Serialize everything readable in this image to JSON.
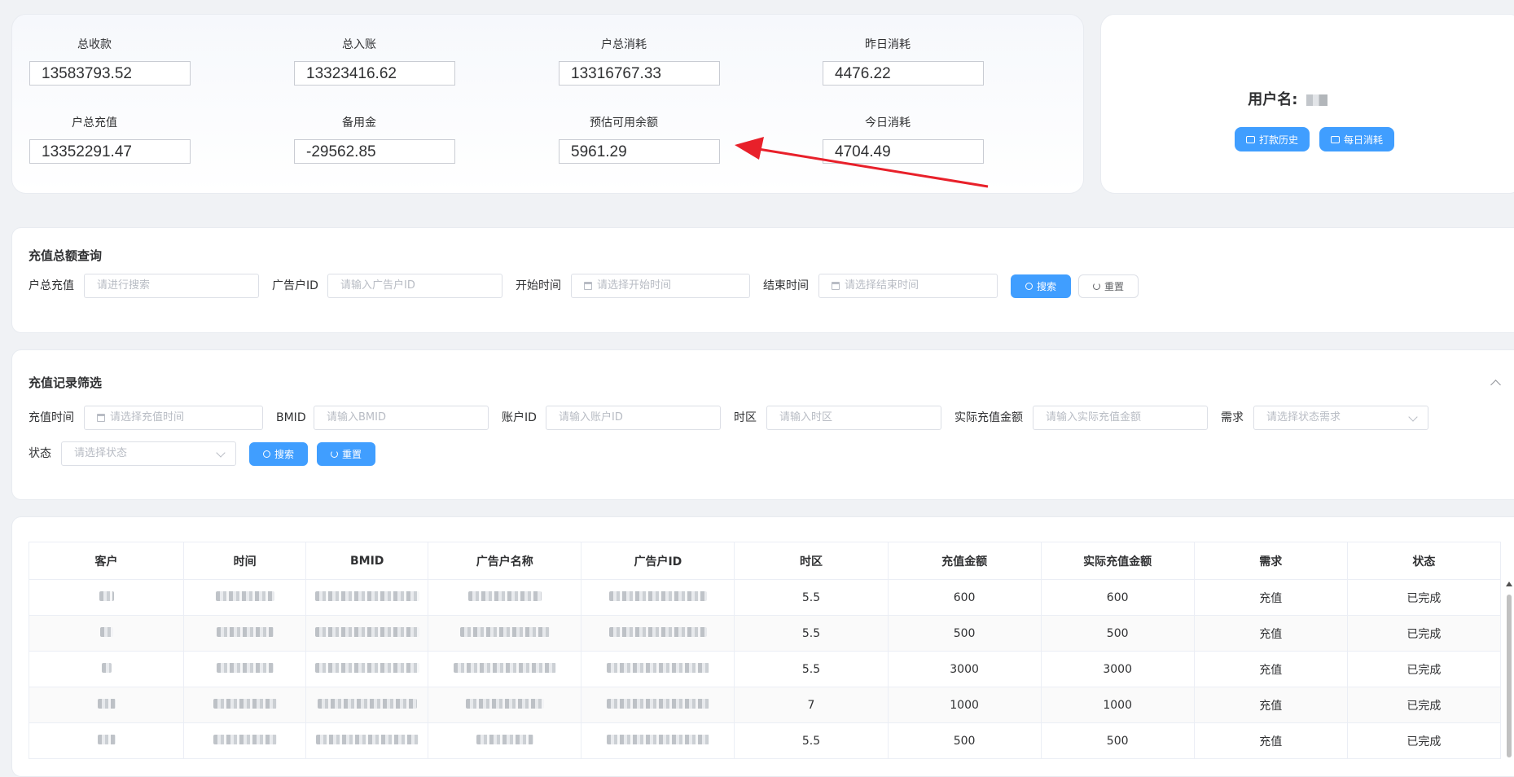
{
  "stats": {
    "row1": [
      {
        "label": "总收款",
        "value": "13583793.52"
      },
      {
        "label": "总入账",
        "value": "13323416.62"
      },
      {
        "label": "户总消耗",
        "value": "13316767.33"
      },
      {
        "label": "昨日消耗",
        "value": "4476.22"
      }
    ],
    "row2": [
      {
        "label": "户总充值",
        "value": "13352291.47"
      },
      {
        "label": "备用金",
        "value": "-29562.85"
      },
      {
        "label": "预估可用余额",
        "value": "5961.29"
      },
      {
        "label": "今日消耗",
        "value": "4704.49"
      }
    ],
    "annotation_color": "#e8202a"
  },
  "user": {
    "title": "用户名:",
    "btn_history": "打款历史",
    "btn_daily": "每日消耗"
  },
  "query": {
    "title": "充值总额查询",
    "label1": "户总充值",
    "ph1": "请进行搜索",
    "label2": "广告户ID",
    "ph2": "请输入广告户ID",
    "label3": "开始时间",
    "ph3": "请选择开始时间",
    "label4": "结束时间",
    "ph4": "请选择结束时间",
    "search": "搜索",
    "reset": "重置"
  },
  "filter": {
    "title": "充值记录筛选",
    "l_time": "充值时间",
    "ph_time": "请选择充值时间",
    "l_bmid": "BMID",
    "ph_bmid": "请输入BMID",
    "l_acct": "账户ID",
    "ph_acct": "请输入账户ID",
    "l_tz": "时区",
    "ph_tz": "请输入时区",
    "l_amt": "实际充值金额",
    "ph_amt": "请输入实际充值金额",
    "l_need": "需求",
    "ph_need": "请选择状态需求",
    "l_status": "状态",
    "ph_status": "请选择状态",
    "search": "搜索",
    "reset": "重置"
  },
  "table": {
    "headers": [
      "客户",
      "时间",
      "BMID",
      "广告户名称",
      "广告户ID",
      "时区",
      "充值金额",
      "实际充值金额",
      "需求",
      "状态"
    ],
    "rows": [
      {
        "tz": "5.5",
        "amount": "600",
        "actual": "600",
        "need": "充值",
        "status": "已完成"
      },
      {
        "tz": "5.5",
        "amount": "500",
        "actual": "500",
        "need": "充值",
        "status": "已完成"
      },
      {
        "tz": "5.5",
        "amount": "3000",
        "actual": "3000",
        "need": "充值",
        "status": "已完成"
      },
      {
        "tz": "7",
        "amount": "1000",
        "actual": "1000",
        "need": "充值",
        "status": "已完成"
      },
      {
        "tz": "5.5",
        "amount": "500",
        "actual": "500",
        "need": "充值",
        "status": "已完成"
      }
    ]
  }
}
